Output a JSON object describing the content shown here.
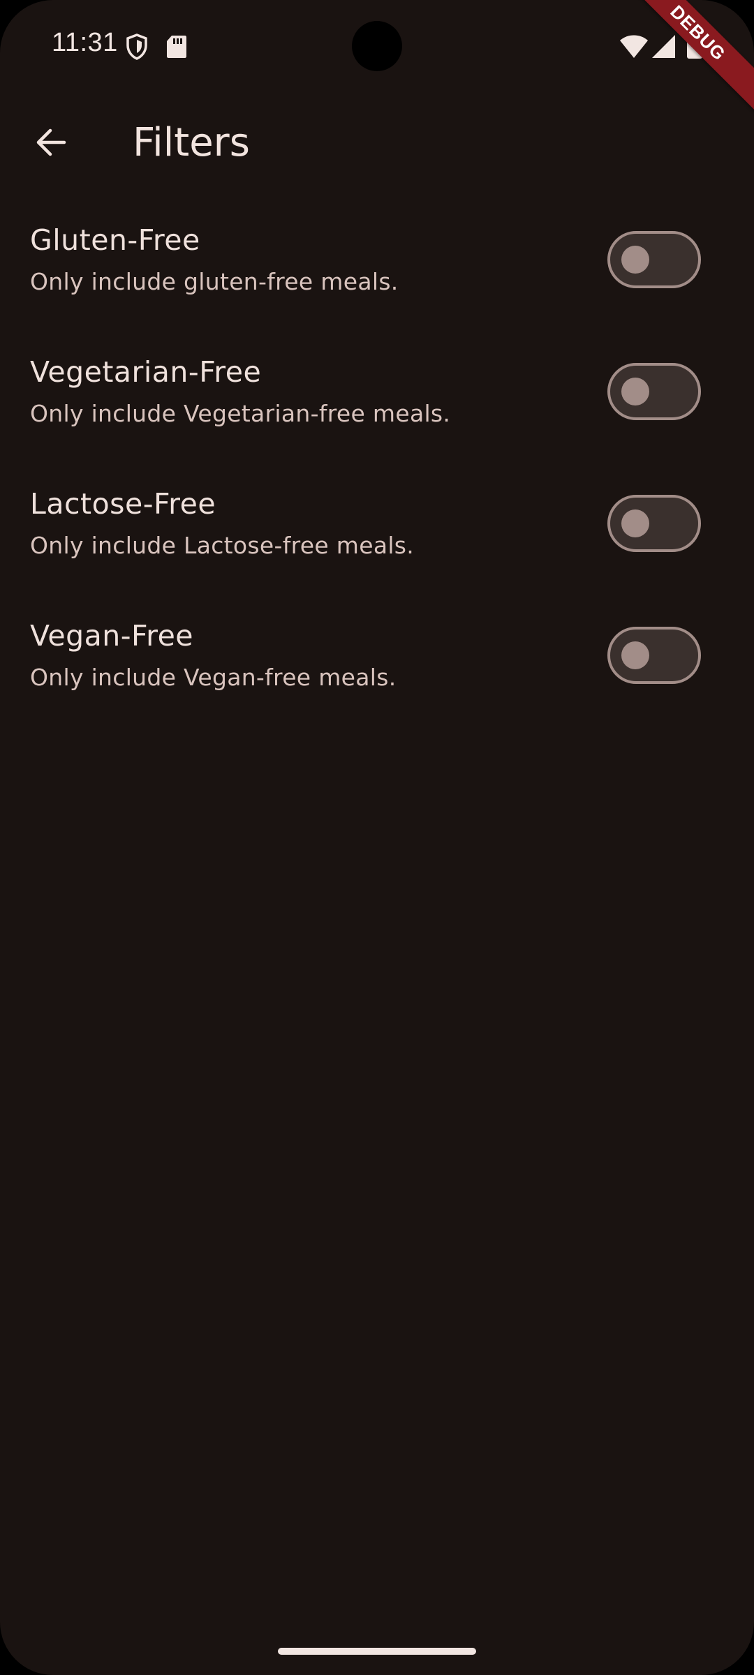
{
  "status_bar": {
    "time": "11:31",
    "icons": [
      "shield-icon",
      "sd-card-icon",
      "wifi-icon",
      "cellular-signal-icon",
      "battery-icon"
    ]
  },
  "debug_banner": {
    "label": "DEBUG",
    "color": "#8a1a1f"
  },
  "app_bar": {
    "back_icon": "arrow-back-icon",
    "title": "Filters"
  },
  "filters": [
    {
      "title": "Gluten-Free",
      "subtitle": "Only include gluten-free meals.",
      "enabled": false
    },
    {
      "title": "Vegetarian-Free",
      "subtitle": "Only include Vegetarian-free meals.",
      "enabled": false
    },
    {
      "title": "Lactose-Free",
      "subtitle": "Only include Lactose-free meals.",
      "enabled": false
    },
    {
      "title": "Vegan-Free",
      "subtitle": "Only include Vegan-free meals.",
      "enabled": false
    }
  ],
  "colors": {
    "background": "#1a1311",
    "text_primary": "#efe1dc",
    "text_secondary": "#d9c4be",
    "switch_outline": "#a28d88",
    "switch_track": "#3a302d"
  }
}
